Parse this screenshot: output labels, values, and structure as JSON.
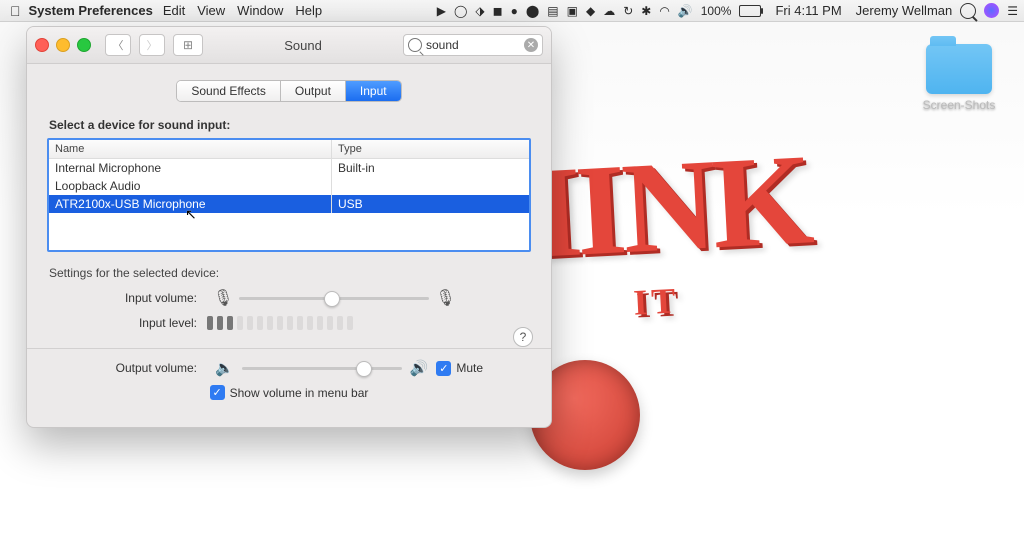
{
  "menubar": {
    "app_title": "System Preferences",
    "items": [
      "Edit",
      "View",
      "Window",
      "Help"
    ],
    "battery": "100%",
    "clock": "Fri 4:11 PM",
    "username": "Jeremy Wellman"
  },
  "desktop": {
    "folder_name": "Screen-Shots",
    "wallpaper_line1": "HINK",
    "wallpaper_line2": "IT"
  },
  "window": {
    "title": "Sound",
    "search_value": "sound",
    "tabs": [
      "Sound Effects",
      "Output",
      "Input"
    ],
    "selected_tab": 2,
    "heading": "Select a device for sound input:",
    "columns": {
      "name": "Name",
      "type": "Type"
    },
    "devices": [
      {
        "name": "Internal Microphone",
        "type": "Built-in",
        "selected": false
      },
      {
        "name": "Loopback Audio",
        "type": "",
        "selected": false
      },
      {
        "name": "ATR2100x-USB Microphone",
        "type": "USB",
        "selected": true
      }
    ],
    "settings_heading": "Settings for the selected device:",
    "input_volume_label": "Input volume:",
    "input_level_label": "Input level:",
    "output_volume_label": "Output volume:",
    "mute_label": "Mute",
    "show_volume_label": "Show volume in menu bar",
    "mute_checked": true,
    "show_volume_checked": true,
    "input_volume_pct": 48,
    "output_volume_pct": 78,
    "input_level_active": 3
  }
}
